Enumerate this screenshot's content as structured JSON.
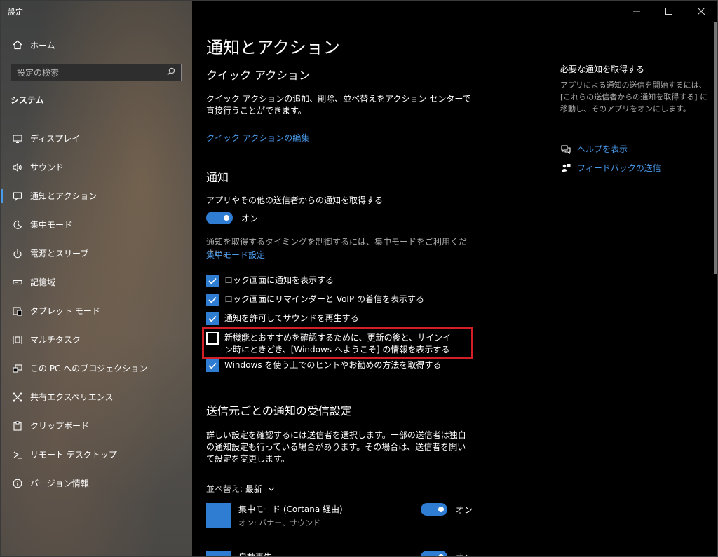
{
  "window": {
    "title": "設定",
    "controls": {
      "minimize": "—",
      "maximize": "☐",
      "close": "✕"
    }
  },
  "sidebar": {
    "home": {
      "icon": "home-icon",
      "label": "ホーム"
    },
    "search": {
      "placeholder": "設定の検索",
      "icon": "search-icon"
    },
    "section": "システム",
    "items": [
      {
        "icon": "display-icon",
        "label": "ディスプレイ",
        "active": false
      },
      {
        "icon": "sound-icon",
        "label": "サウンド",
        "active": false
      },
      {
        "icon": "notifications-icon",
        "label": "通知とアクション",
        "active": true
      },
      {
        "icon": "focus-assist-icon",
        "label": "集中モード",
        "active": false
      },
      {
        "icon": "power-icon",
        "label": "電源とスリープ",
        "active": false
      },
      {
        "icon": "storage-icon",
        "label": "記憶域",
        "active": false
      },
      {
        "icon": "tablet-icon",
        "label": "タブレット モード",
        "active": false
      },
      {
        "icon": "multitask-icon",
        "label": "マルチタスク",
        "active": false
      },
      {
        "icon": "projection-icon",
        "label": "この PC へのプロジェクション",
        "active": false
      },
      {
        "icon": "share-icon",
        "label": "共有エクスペリエンス",
        "active": false
      },
      {
        "icon": "clipboard-icon",
        "label": "クリップボード",
        "active": false
      },
      {
        "icon": "remote-desktop-icon",
        "label": "リモート デスクトップ",
        "active": false
      },
      {
        "icon": "info-icon",
        "label": "バージョン情報",
        "active": false
      }
    ]
  },
  "main": {
    "title": "通知とアクション",
    "quick_actions": {
      "heading": "クイック アクション",
      "description": "クイック アクションの追加、削除、並べ替えをアクション センターで直接行うことができます。",
      "edit_link": "クイック アクションの編集"
    },
    "notifications": {
      "heading": "通知",
      "get_label": "アプリやその他の送信者からの通知を取得する",
      "toggle_state": "オン",
      "focus_text": "通知を取得するタイミングを制御するには、集中モードをご利用ください。",
      "focus_link": "集中モード設定",
      "checkboxes": [
        {
          "label": "ロック画面に通知を表示する",
          "checked": true
        },
        {
          "label": "ロック画面にリマインダーと VoIP の着信を表示する",
          "checked": true
        },
        {
          "label": "通知を許可してサウンドを再生する",
          "checked": true
        },
        {
          "label": "新機能とおすすめを確認するために、更新の後と、サインイン時にときどき、[Windows へようこそ] の情報を表示する",
          "checked": false
        },
        {
          "label": "Windows を使う上でのヒントやお勧めの方法を取得する",
          "checked": true
        }
      ]
    },
    "senders": {
      "heading": "送信元ごとの通知の受信設定",
      "description": "詳しい設定を確認するには送信者を選択します。一部の送信者は独自の通知設定も行っている場合があります。その場合は、送信者を開いて設定を変更します。",
      "sort_label": "並べ替え:",
      "sort_value": "最新",
      "items": [
        {
          "name": "集中モード (Cortana 経由)",
          "sub": "オン: バナー、サウンド",
          "toggle": "オン"
        },
        {
          "name": "自動再生",
          "sub": "",
          "toggle": "オン"
        }
      ]
    }
  },
  "right_panel": {
    "title": "必要な通知を取得する",
    "text": "アプリによる通知の送信を開始するには、[これらの送信者からの通知を取得する] に移動し、そのアプリをオンにします。",
    "links": [
      {
        "icon": "help-icon",
        "label": "ヘルプを表示"
      },
      {
        "icon": "feedback-icon",
        "label": "フィードバックの送信"
      }
    ]
  }
}
